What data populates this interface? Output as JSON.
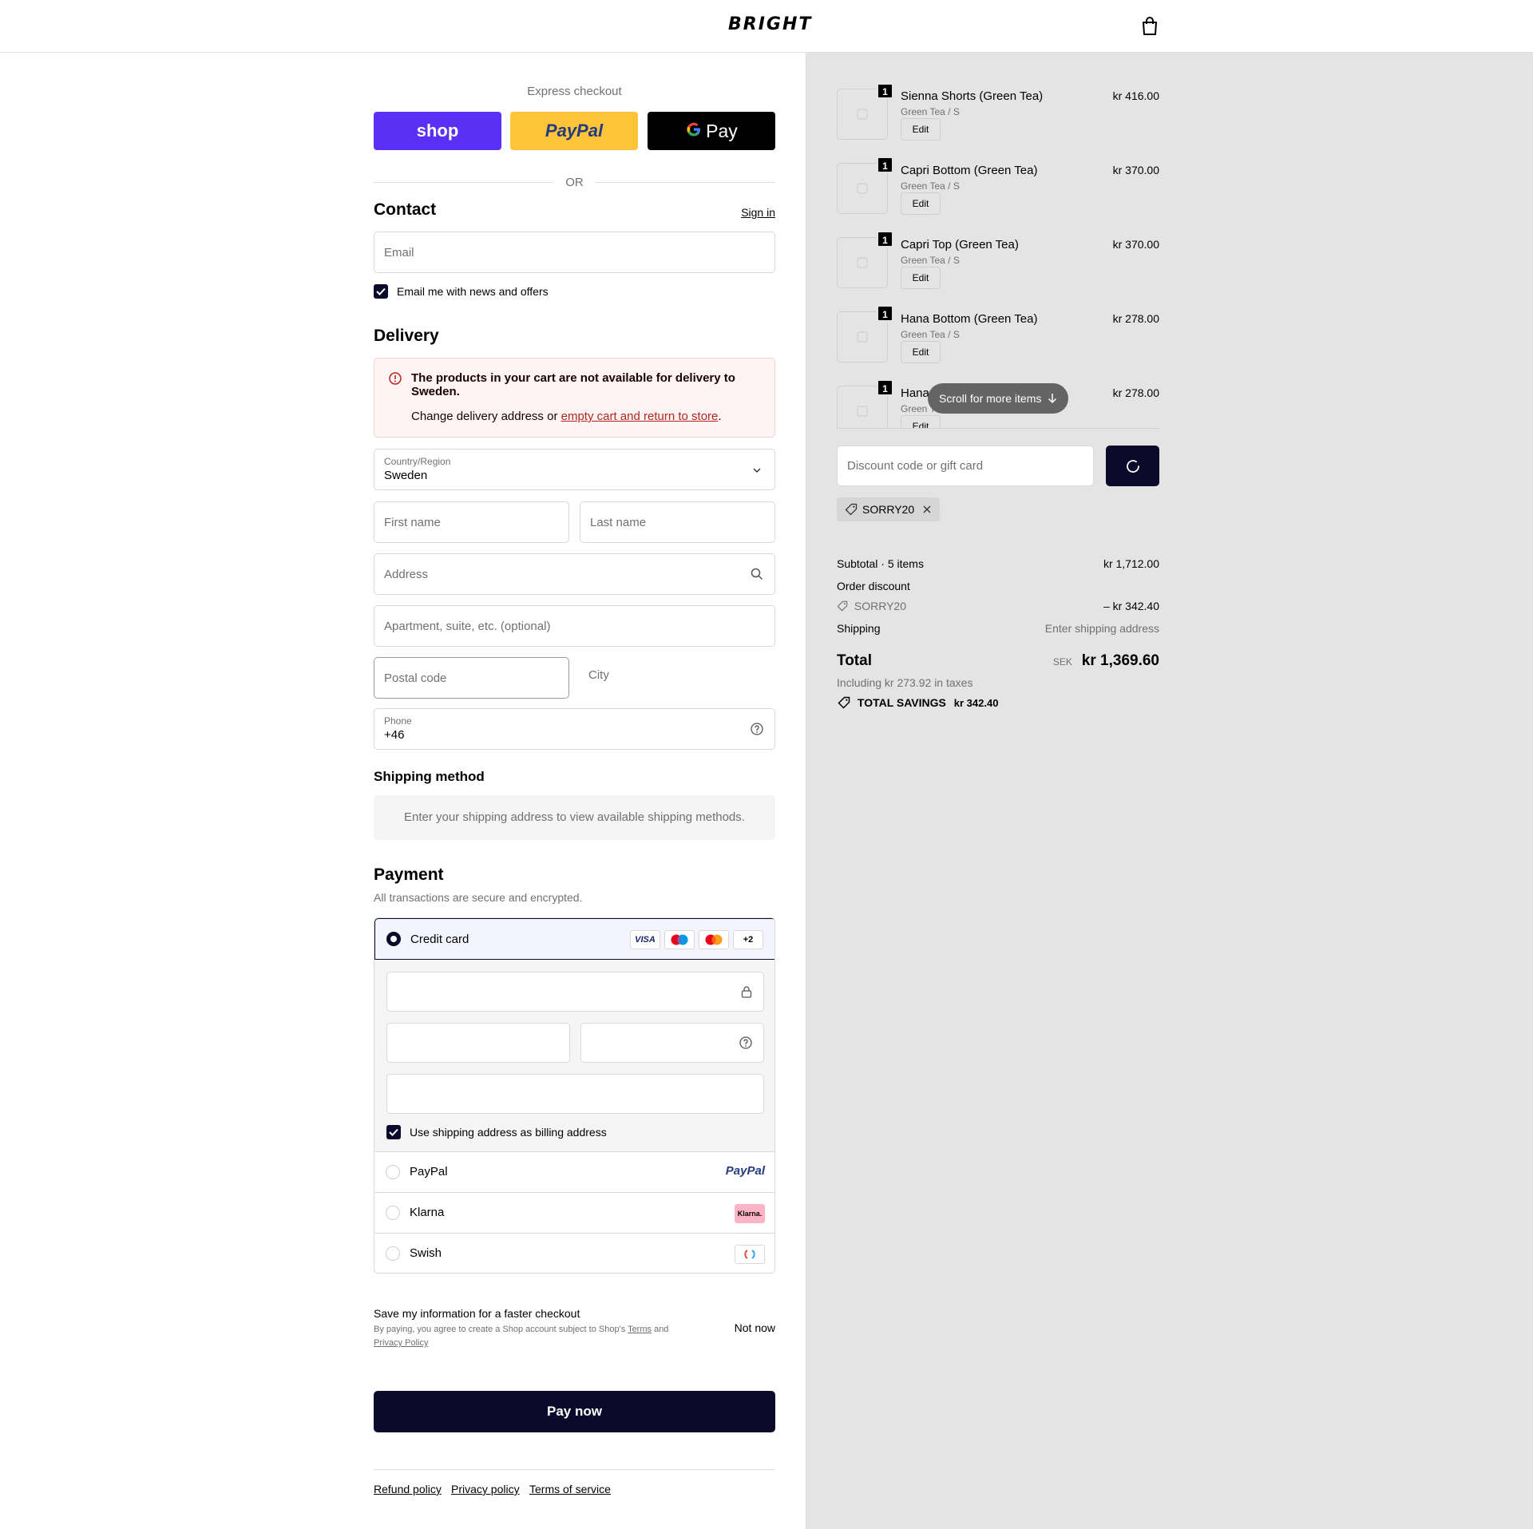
{
  "header": {
    "logo": "BRIGHT",
    "cart_icon": "shopping-bag-icon"
  },
  "express": {
    "label": "Express checkout",
    "shop_label": "shop",
    "paypal_label": "PayPal",
    "gpay_label": "Pay",
    "or_label": "OR",
    "colors": {
      "shop": "#5a31f4",
      "paypal": "#ffc439",
      "gpay": "#000000"
    }
  },
  "contact": {
    "title": "Contact",
    "sign_in": "Sign in",
    "email_placeholder": "Email",
    "newsletter_label": "Email me with news and offers",
    "newsletter_checked": true
  },
  "delivery": {
    "title": "Delivery",
    "alert_title": "The products in your cart are not available for delivery to Sweden.",
    "alert_text": "Change delivery address or ",
    "alert_link": "empty cart and return to store",
    "alert_end": ".",
    "country_label": "Country/Region",
    "country_value": "Sweden",
    "first_name_placeholder": "First name",
    "last_name_placeholder": "Last name",
    "address_placeholder": "Address",
    "apartment_placeholder": "Apartment, suite, etc. (optional)",
    "postal_placeholder": "Postal code",
    "city_placeholder": "City",
    "phone_label": "Phone",
    "phone_value": "+46"
  },
  "shipping_method": {
    "title": "Shipping method",
    "message": "Enter your shipping address to view available shipping methods."
  },
  "payment": {
    "title": "Payment",
    "subtitle": "All transactions are secure and encrypted.",
    "credit_card_label": "Credit card",
    "card_badges": [
      "VISA",
      "maestro",
      "mastercard",
      "+2"
    ],
    "billing_label": "Use shipping address as billing address",
    "billing_checked": true,
    "options": [
      {
        "name": "PayPal",
        "logo": "PayPal"
      },
      {
        "name": "Klarna",
        "logo": "Klarna."
      },
      {
        "name": "Swish",
        "logo": "swish-logo"
      }
    ]
  },
  "save_info": {
    "title": "Save my information for a faster checkout",
    "text_prefix": "By paying, you agree to create a Shop account subject to Shop's ",
    "terms_link": "Terms",
    "and": " and",
    "privacy_link": "Privacy Policy",
    "not_now": "Not now"
  },
  "pay_now": "Pay now",
  "footer_links": [
    "Refund policy",
    "Privacy policy",
    "Terms of service"
  ],
  "cart": {
    "items": [
      {
        "qty": "1",
        "name": "Sienna Shorts (Green Tea)",
        "variant": "Green Tea / S",
        "price": "kr 416.00",
        "edit": "Edit"
      },
      {
        "qty": "1",
        "name": "Capri Bottom (Green Tea)",
        "variant": "Green Tea / S",
        "price": "kr 370.00",
        "edit": "Edit"
      },
      {
        "qty": "1",
        "name": "Capri Top (Green Tea)",
        "variant": "Green Tea / S",
        "price": "kr 370.00",
        "edit": "Edit"
      },
      {
        "qty": "1",
        "name": "Hana Bottom (Green Tea)",
        "variant": "Green Tea / S",
        "price": "kr 278.00",
        "edit": "Edit"
      },
      {
        "qty": "1",
        "name": "Hana",
        "variant": "Green T",
        "price": "kr 278.00",
        "edit": "Edit"
      }
    ],
    "scroll_hint": "Scroll for more items",
    "discount_placeholder": "Discount code or gift card",
    "applied_code": "SORRY20",
    "subtotal_label": "Subtotal · 5 items",
    "subtotal_value": "kr 1,712.00",
    "order_discount_label": "Order discount",
    "discount_code": "SORRY20",
    "discount_value": "– kr 342.40",
    "shipping_label": "Shipping",
    "shipping_value": "Enter shipping address",
    "total_label": "Total",
    "currency": "SEK",
    "total_value": "kr 1,369.60",
    "taxes": "Including kr 273.92 in taxes",
    "savings_label": "TOTAL SAVINGS",
    "savings_value": "kr 342.40"
  }
}
